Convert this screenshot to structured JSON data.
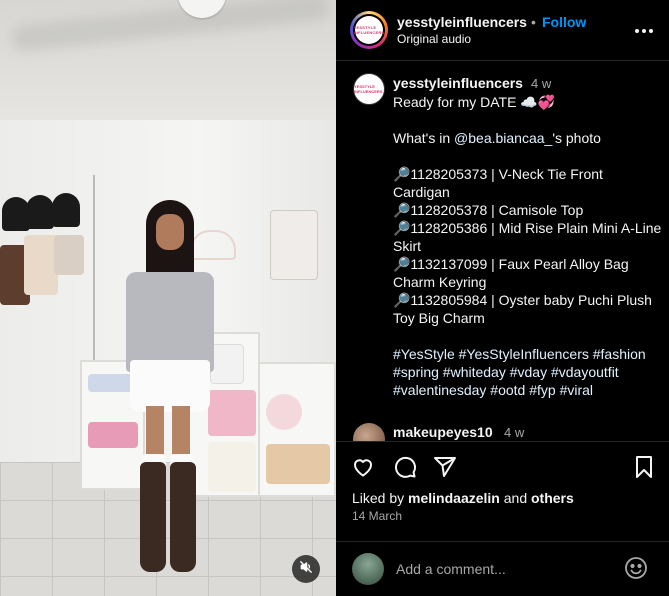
{
  "post": {
    "username": "yesstyleinfluencers",
    "separator": "•",
    "follow_label": "Follow",
    "audio": "Original audio",
    "avatar_text": "YESSTYLE INFLUENCERS"
  },
  "caption_comment": {
    "username": "yesstyleinfluencers",
    "time": "4 w",
    "line1": "Ready for my DATE ☁️💞",
    "line2_prefix": "What's in ",
    "mention": "@bea.biancaa_",
    "line2_suffix": "'s photo",
    "items": [
      "🔎1128205373 | V-Neck Tie Front Cardigan",
      "🔎1128205378 | Camisole Top",
      "🔎1128205386 | Mid Rise Plain Mini A-Line Skirt",
      "🔎1132137099 | Faux Pearl Alloy Bag Charm Keyring",
      "🔎1132805984 | Oyster baby Puchi Plush Toy Big Charm"
    ],
    "hashtags": "#YesStyle #YesStyleInfluencers #fashion #spring #whiteday #vday #vdayoutfit #valentinesday #ootd #fyp #viral"
  },
  "next_comment": {
    "username": "makeupeyes10",
    "time": "4 w"
  },
  "actions": {
    "liked_prefix": "Liked by ",
    "liked_user": "melindaazelin",
    "liked_and": " and ",
    "liked_others": "others",
    "date": "14 March"
  },
  "add_comment": {
    "placeholder": "Add a comment..."
  },
  "icons": {
    "mute": "speaker-muted-icon",
    "more": "more-horizontal-icon",
    "like": "heart-icon",
    "comment": "comment-bubble-icon",
    "share": "paper-plane-icon",
    "save": "bookmark-icon",
    "emoji": "emoji-smile-icon"
  },
  "colors": {
    "accent": "#0095f6",
    "text": "#f5f5f5",
    "muted": "#a8a8a8",
    "background": "#000000",
    "divider": "#262626"
  }
}
